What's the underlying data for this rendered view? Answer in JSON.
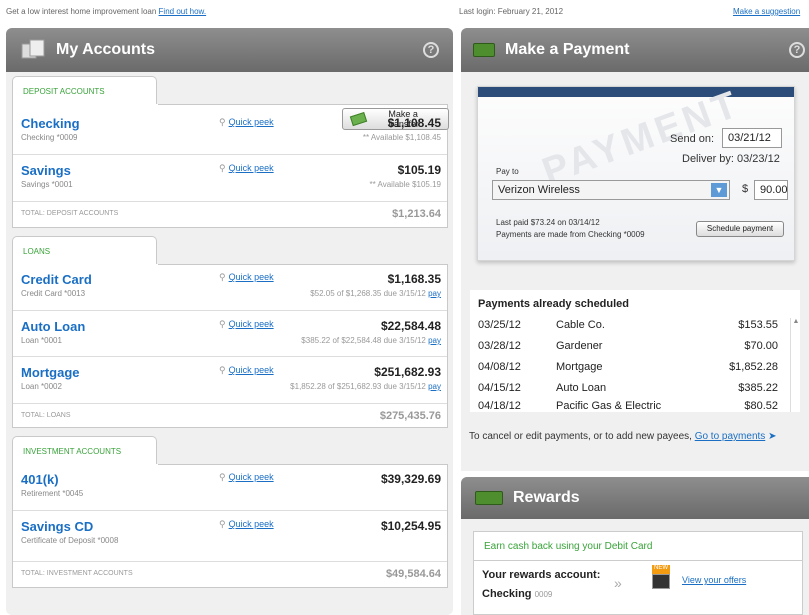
{
  "top": {
    "promo": "Get a low interest home improvement loan",
    "promo_link": "Find out how.",
    "last_login": "Last login: February 21, 2012",
    "suggestion": "Make a suggestion"
  },
  "accounts": {
    "title": "My Accounts",
    "help": "?",
    "transfer_label": "Make a transfer",
    "quick_peek": "Quick peek",
    "pay": "pay",
    "deposit": {
      "tab": "DEPOSIT ACCOUNTS",
      "rows": [
        {
          "name": "Checking",
          "sub": "Checking *0009",
          "amount": "$1,108.45",
          "detail": "** Available $1,108.45"
        },
        {
          "name": "Savings",
          "sub": "Savings *0001",
          "amount": "$105.19",
          "detail": "** Available $105.19"
        }
      ],
      "total_label": "TOTAL: DEPOSIT ACCOUNTS",
      "total": "$1,213.64"
    },
    "loans": {
      "tab": "LOANS",
      "rows": [
        {
          "name": "Credit Card",
          "sub": "Credit Card *0013",
          "amount": "$1,168.35",
          "detail": "$52.05 of $1,268.35 due 3/15/12"
        },
        {
          "name": "Auto Loan",
          "sub": "Loan *0001",
          "amount": "$22,584.48",
          "detail": "$385.22 of $22,584.48 due 3/15/12"
        },
        {
          "name": "Mortgage",
          "sub": "Loan *0002",
          "amount": "$251,682.93",
          "detail": "$1,852.28 of $251,682.93 due 3/15/12"
        }
      ],
      "total_label": "TOTAL: LOANS",
      "total": "$275,435.76"
    },
    "invest": {
      "tab": "INVESTMENT ACCOUNTS",
      "rows": [
        {
          "name": "401(k)",
          "sub": "Retirement *0045",
          "amount": "$39,329.69",
          "detail": ""
        },
        {
          "name": "Savings CD",
          "sub": "Certificate of Deposit *0008",
          "amount": "$10,254.95",
          "detail": ""
        }
      ],
      "total_label": "TOTAL: INVESTMENT ACCOUNTS",
      "total": "$49,584.64"
    }
  },
  "payment": {
    "title": "Make a Payment",
    "watermark": "PAYMENT",
    "send_on_label": "Send on:",
    "send_on": "03/21/12",
    "deliver_by": "Deliver by: 03/23/12",
    "pay_to_label": "Pay to",
    "payee": "Verizon Wireless",
    "currency": "$",
    "amount": "90.00",
    "last_paid": "Last paid $73.24 on 03/14/12",
    "from_note": "Payments are made from Checking *0009",
    "schedule_label": "Schedule payment",
    "scheduled_title": "Payments already scheduled",
    "scheduled": [
      {
        "date": "03/25/12",
        "payee": "Cable Co.",
        "amount": "$153.55"
      },
      {
        "date": "03/28/12",
        "payee": "Gardener",
        "amount": "$70.00"
      },
      {
        "date": "04/08/12",
        "payee": "Mortgage",
        "amount": "$1,852.28"
      },
      {
        "date": "04/15/12",
        "payee": "Auto Loan",
        "amount": "$385.22"
      },
      {
        "date": "04/18/12",
        "payee": "Pacific Gas & Electric",
        "amount": "$80.52"
      }
    ],
    "cancel_note": "To cancel or edit payments, or to add new payees,",
    "goto_link": "Go to payments"
  },
  "rewards": {
    "title": "Rewards",
    "earn": "Earn cash back using your Debit Card",
    "acct_label": "Your rewards account:",
    "acct_name": "Checking",
    "acct_num": "0009",
    "new_badge": "NEW",
    "offers": "View your offers"
  }
}
